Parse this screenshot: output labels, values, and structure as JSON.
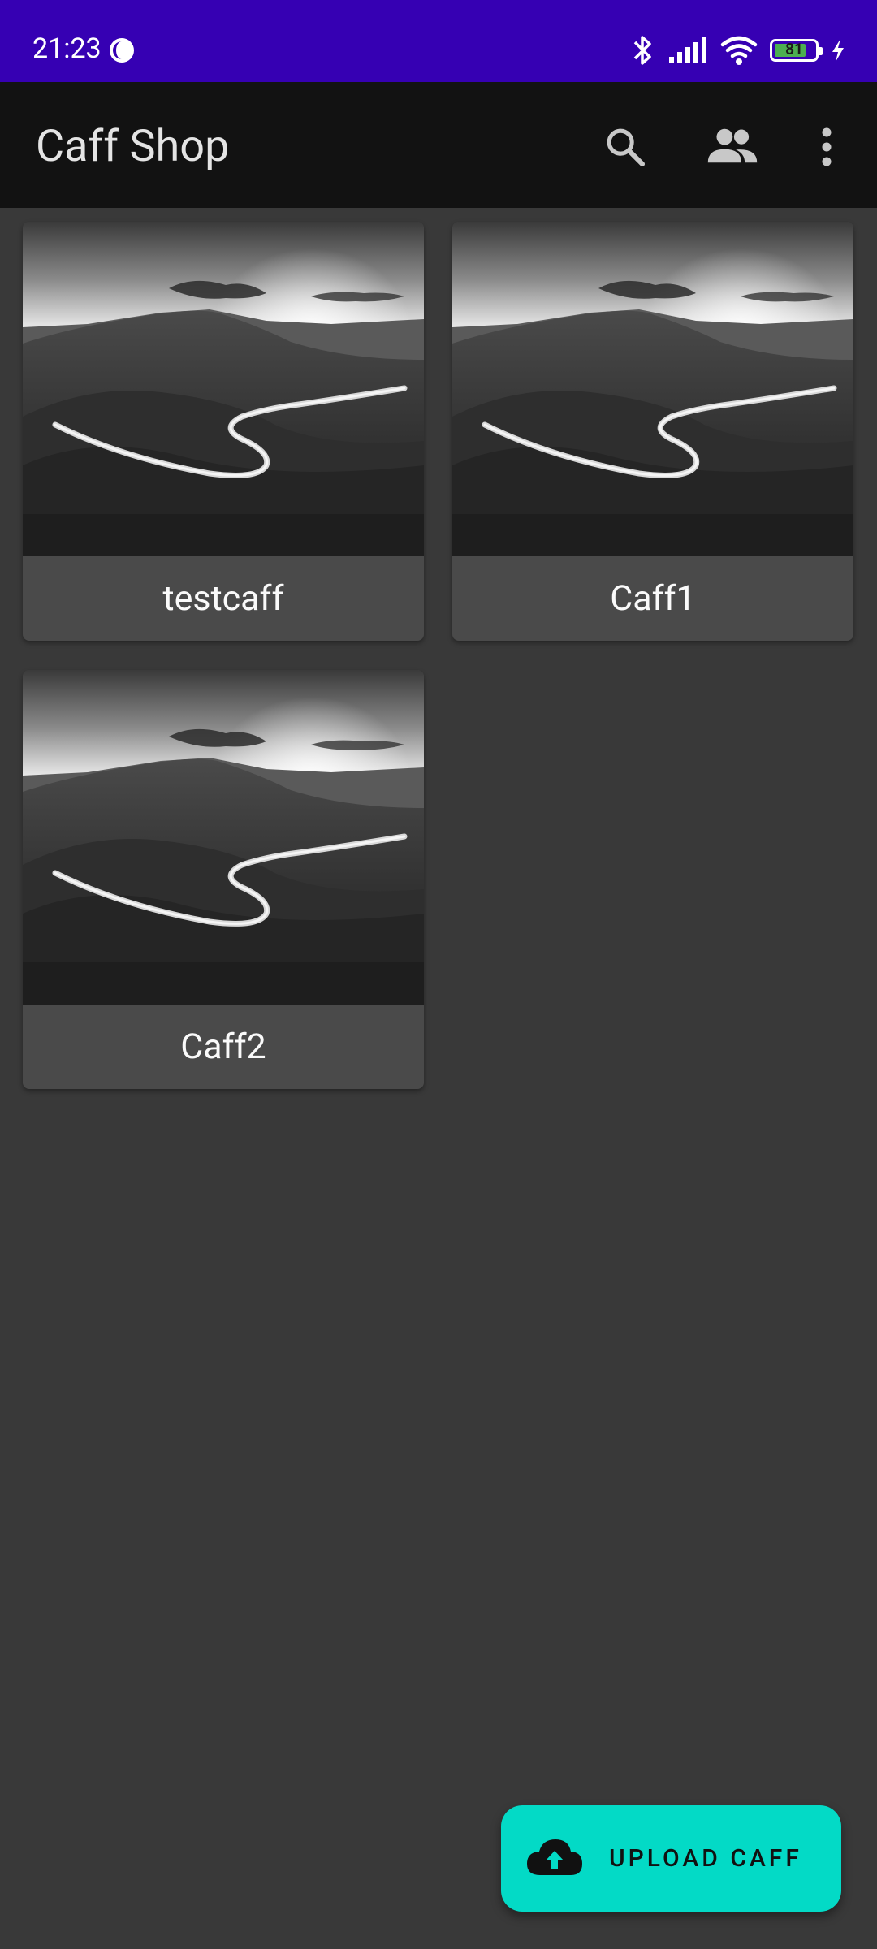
{
  "status_bar": {
    "time": "21:23",
    "battery": "81",
    "battery_level": 0.81,
    "icons": [
      "moon-icon",
      "bluetooth-icon",
      "signal-icon",
      "wifi-icon",
      "battery-icon",
      "charging-icon"
    ]
  },
  "app_bar": {
    "title": "Caff Shop",
    "actions": [
      "search-icon",
      "people-icon",
      "more-vert-icon"
    ]
  },
  "caffs": [
    {
      "title": "testcaff"
    },
    {
      "title": "Caff1"
    },
    {
      "title": "Caff2"
    }
  ],
  "fab": {
    "label": "UPLOAD CAFF",
    "icon": "cloud-upload-icon"
  },
  "colors": {
    "status_bar": "#3600b3",
    "app_bar": "#121212",
    "background": "#393939",
    "card": "#4a4a4a",
    "fab": "#03dac6"
  }
}
